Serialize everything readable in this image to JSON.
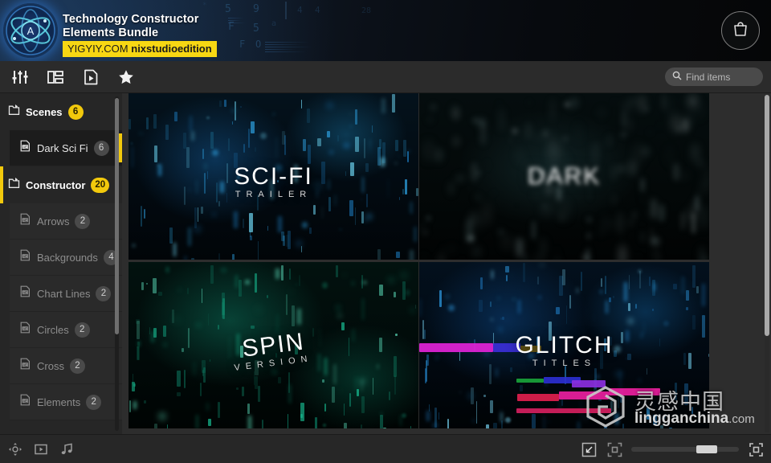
{
  "header": {
    "title": "Technology Constructor\nElements Bundle",
    "badge_site": "YIGYIY.COM",
    "badge_brand": "nixstudioedition",
    "logo_letter": "A",
    "logo_name": "atom-logo-icon",
    "cart_icon": "shopping-bag-icon"
  },
  "toolbar": {
    "icons": [
      {
        "name": "sliders-icon",
        "title": "Filters"
      },
      {
        "name": "list-view-icon",
        "title": "List view"
      },
      {
        "name": "file-play-icon",
        "title": "Project file"
      },
      {
        "name": "star-icon",
        "title": "Favorites"
      }
    ],
    "search": {
      "placeholder": "Find items",
      "value": "",
      "icon": "search-icon"
    }
  },
  "sidebar": {
    "groups": [
      {
        "label": "Scenes",
        "count": "6",
        "icon": "folder-icon",
        "items": [
          {
            "label": "Dark Sci Fi",
            "count": "6",
            "icon": "ae-file-icon",
            "selected": true
          }
        ]
      },
      {
        "label": "Constructor",
        "count": "20",
        "icon": "folder-icon",
        "items": [
          {
            "label": "Arrows",
            "count": "2",
            "icon": "ae-file-icon",
            "selected": false
          },
          {
            "label": "Backgrounds",
            "count": "4",
            "icon": "ae-file-icon",
            "selected": false
          },
          {
            "label": "Chart Lines",
            "count": "2",
            "icon": "ae-file-icon",
            "selected": false
          },
          {
            "label": "Circles",
            "count": "2",
            "icon": "ae-file-icon",
            "selected": false
          },
          {
            "label": "Cross",
            "count": "2",
            "icon": "ae-file-icon",
            "selected": false
          },
          {
            "label": "Elements",
            "count": "2",
            "icon": "ae-file-icon",
            "selected": false
          }
        ]
      }
    ]
  },
  "gallery": {
    "items": [
      {
        "title": "SCI-FI",
        "subtitle": "TRAILER",
        "theme": "scifi"
      },
      {
        "title": "DARK",
        "subtitle": "",
        "theme": "dark"
      },
      {
        "title": "SPIN",
        "subtitle": "VERSION",
        "theme": "spin"
      },
      {
        "title": "GLITCH",
        "subtitle": "TITLES",
        "theme": "glitch"
      }
    ]
  },
  "watermark": {
    "cn": "灵感中国",
    "brand": "lingganchina",
    "domain": ".com"
  },
  "bottombar": {
    "left_icons": [
      {
        "name": "pan-move-icon",
        "title": "Pan"
      },
      {
        "name": "video-preview-icon",
        "title": "Video"
      },
      {
        "name": "audio-note-icon",
        "title": "Audio"
      }
    ],
    "right_icons": [
      {
        "name": "expand-icon",
        "title": "Expand"
      },
      {
        "name": "fit-icon",
        "title": "Fit"
      },
      {
        "name": "fullscreen-icon",
        "title": "Fullscreen"
      }
    ],
    "zoom": {
      "value": 75
    }
  },
  "colors": {
    "accent_yellow": "#f2c90c",
    "badge_yellow": "#f7d713",
    "panel_bg": "#262626",
    "main_bg": "#2d2d2d"
  }
}
